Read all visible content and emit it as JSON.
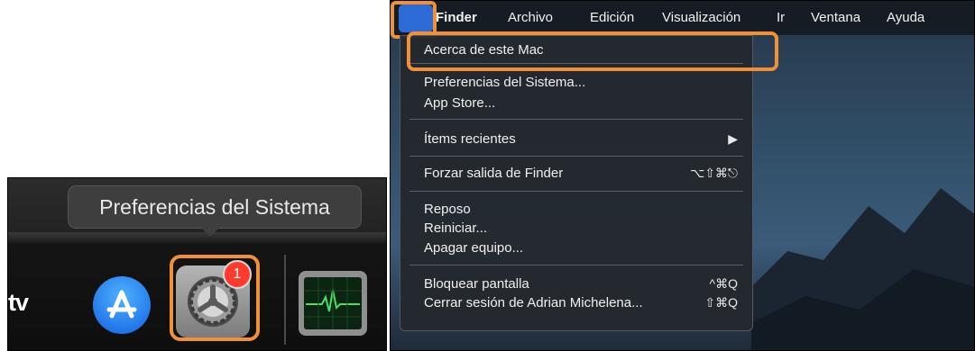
{
  "dock": {
    "tooltip": "Preferencias del Sistema",
    "appletv_label": "tv",
    "badge_count": "1"
  },
  "menubar": {
    "items": [
      "Finder",
      "Archivo",
      "Edición",
      "Visualización",
      "Ir",
      "Ventana",
      "Ayuda"
    ]
  },
  "apple_menu": {
    "about": "Acerca de este Mac",
    "system_prefs": "Preferencias del Sistema...",
    "app_store": "App Store...",
    "recent_items": "Ítems recientes",
    "recent_arrow": "▶",
    "force_quit": "Forzar salida de Finder",
    "force_quit_shortcut": "⌥⇧⌘⎋",
    "sleep": "Reposo",
    "restart": "Reiniciar...",
    "shutdown": "Apagar equipo...",
    "lock_screen": "Bloquear pantalla",
    "lock_screen_shortcut": "^⌘Q",
    "logout": "Cerrar sesión de Adrian Michelena...",
    "logout_shortcut": "⇧⌘Q"
  },
  "colors": {
    "highlight": "#f0913a",
    "apple_button": "#2d6bd6",
    "badge": "#ff3b30"
  },
  "icons": {
    "apple": "apple-icon",
    "app_store": "app-store-icon",
    "system_prefs": "system-preferences-icon",
    "activity_monitor": "activity-monitor-icon"
  }
}
